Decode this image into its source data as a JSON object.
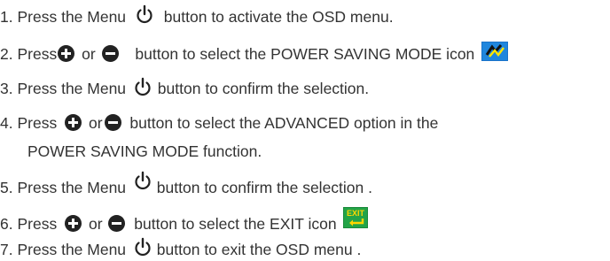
{
  "steps": [
    {
      "num": "1.",
      "parts": [
        "Press the Menu",
        "button to activate the OSD menu."
      ]
    },
    {
      "num": "2.",
      "parts": [
        "Press",
        "or",
        "button to select the POWER SAVING MODE icon"
      ]
    },
    {
      "num": "3.",
      "parts": [
        "Press the Menu",
        "button to confirm the selection."
      ]
    },
    {
      "num": "4.",
      "parts": [
        "Press",
        "or",
        "button to select the ADVANCED option in the"
      ],
      "continuation": "POWER SAVING MODE function."
    },
    {
      "num": "5.",
      "parts": [
        "Press the Menu",
        "button to confirm the selection ."
      ]
    },
    {
      "num": "6.",
      "parts": [
        "Press",
        "or",
        "button to select the EXIT icon"
      ]
    },
    {
      "num": "7.",
      "parts": [
        "Press the Menu",
        "button to exit the OSD menu  ."
      ]
    }
  ],
  "icons": {
    "power": "power-icon",
    "plus": "plus-circle-icon",
    "minus": "minus-circle-icon",
    "power_saving": "power-saving-mode-icon",
    "exit": "exit-icon",
    "exit_text": "EXIT"
  },
  "colors": {
    "text": "#333333",
    "icon_dark": "#222222",
    "psm_bg": "#1a73c9",
    "exit_bg": "#1a8a3a",
    "exit_text": "#ffd600"
  }
}
